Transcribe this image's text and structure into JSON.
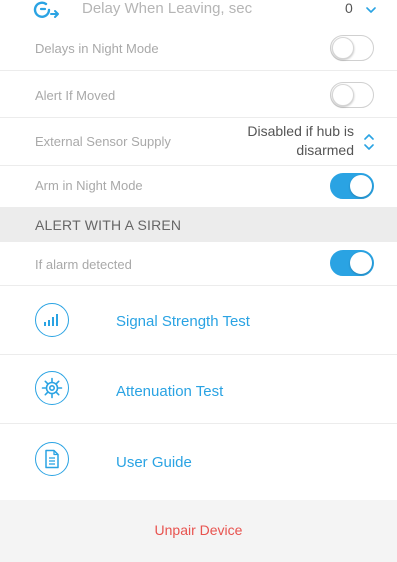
{
  "delay_leaving": {
    "label": "Delay When Leaving, sec",
    "value": "0",
    "icon": "timer-arrow-icon"
  },
  "delays_night_mode": {
    "label": "Delays in Night Mode",
    "enabled": false
  },
  "alert_if_moved": {
    "label": "Alert If Moved",
    "enabled": false
  },
  "external_sensor_supply": {
    "label": "External Sensor Supply",
    "value_line1": "Disabled if hub is",
    "value_line2": "disarmed"
  },
  "arm_night_mode": {
    "label": "Arm in Night Mode",
    "enabled": true
  },
  "siren_section": {
    "title": "ALERT WITH A SIREN"
  },
  "if_alarm_detected": {
    "label": "If alarm detected",
    "enabled": true
  },
  "actions": [
    {
      "label": "Signal Strength Test",
      "icon": "signal-bars-icon"
    },
    {
      "label": "Attenuation Test",
      "icon": "gear-icon"
    },
    {
      "label": "User Guide",
      "icon": "document-icon"
    }
  ],
  "unpair": {
    "label": "Unpair Device"
  },
  "colors": {
    "accent": "#2aa3e3",
    "danger": "#e8534f",
    "section_bg": "#ececec",
    "footer_bg": "#f4f4f4"
  }
}
